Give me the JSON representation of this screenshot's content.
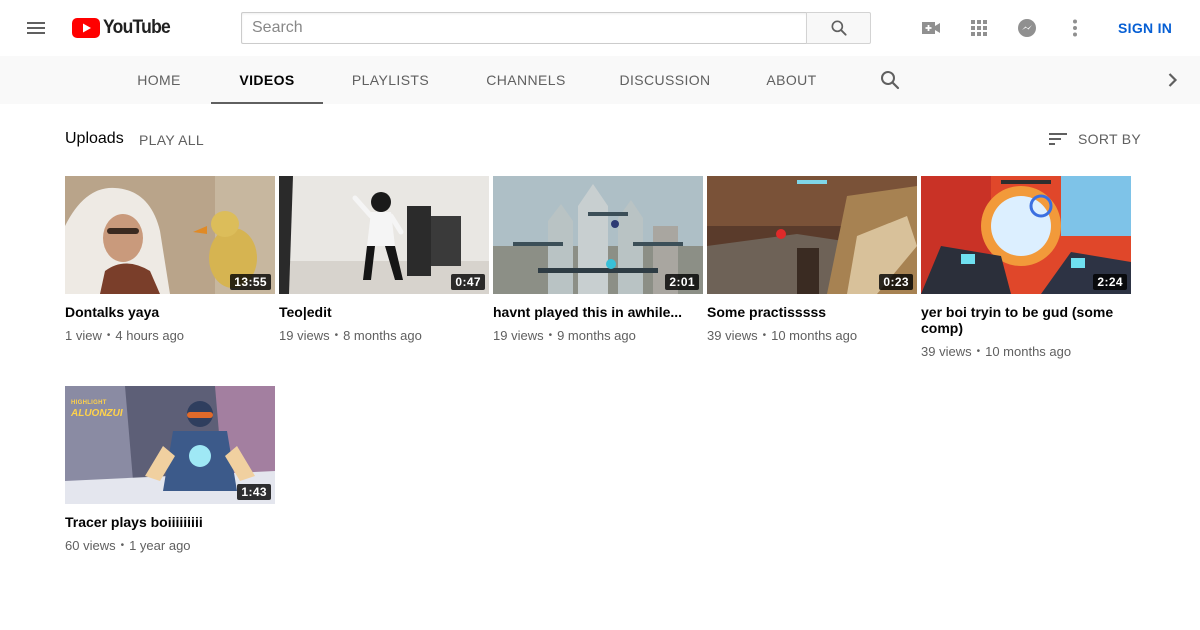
{
  "masthead": {
    "logo_text": "YouTube",
    "search_placeholder": "Search",
    "sign_in": "SIGN IN"
  },
  "tabs": [
    {
      "label": "HOME"
    },
    {
      "label": "VIDEOS"
    },
    {
      "label": "PLAYLISTS"
    },
    {
      "label": "CHANNELS"
    },
    {
      "label": "DISCUSSION"
    },
    {
      "label": "ABOUT"
    }
  ],
  "active_tab": "VIDEOS",
  "section": {
    "title": "Uploads",
    "play_all": "PLAY ALL",
    "sort_by": "SORT BY"
  },
  "videos": [
    {
      "title": "Dontalks yaya",
      "duration": "13:55",
      "views": "1 view",
      "age": "4 hours ago"
    },
    {
      "title": "Teo|edit",
      "duration": "0:47",
      "views": "19 views",
      "age": "8 months ago"
    },
    {
      "title": "havnt played this in awhile...",
      "duration": "2:01",
      "views": "19 views",
      "age": "9 months ago"
    },
    {
      "title": "Some practisssss",
      "duration": "0:23",
      "views": "39 views",
      "age": "10 months ago"
    },
    {
      "title": "yer boi tryin to be gud (some comp)",
      "duration": "2:24",
      "views": "39 views",
      "age": "10 months ago"
    },
    {
      "title": "Tracer plays boiiiiiiiii",
      "duration": "1:43",
      "views": "60 views",
      "age": "1 year ago"
    }
  ],
  "thumbnail_text": {
    "video6_overlay_1": "HIGHLIGHT",
    "video6_overlay_2": "ALUONZUI"
  },
  "icons": {
    "menu": "hamburger-menu-icon",
    "search": "magnifier-icon",
    "upload": "video-camera-plus-icon",
    "apps": "grid-apps-icon",
    "messages": "chat-bubble-icon",
    "more": "vertical-dots-icon",
    "sort": "sort-lines-icon",
    "next": "chevron-right-icon"
  },
  "colors": {
    "brand_red": "#ff0000",
    "link_blue": "#065fd4",
    "tabbar_bg": "#f9f9f9",
    "meta_text": "#606060"
  }
}
